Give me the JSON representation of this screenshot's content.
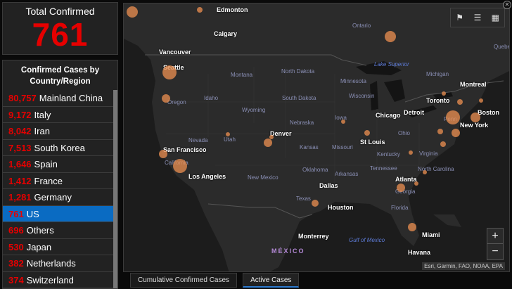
{
  "total": {
    "title": "Total Confirmed",
    "value": "761"
  },
  "list": {
    "title_line1": "Confirmed Cases by",
    "title_line2": "Country/Region",
    "items": [
      {
        "count": "80,757",
        "name": "Mainland China"
      },
      {
        "count": "9,172",
        "name": "Italy"
      },
      {
        "count": "8,042",
        "name": "Iran"
      },
      {
        "count": "7,513",
        "name": "South Korea"
      },
      {
        "count": "1,646",
        "name": "Spain"
      },
      {
        "count": "1,412",
        "name": "France"
      },
      {
        "count": "1,281",
        "name": "Germany"
      },
      {
        "count": "761",
        "name": "US"
      },
      {
        "count": "696",
        "name": "Others"
      },
      {
        "count": "530",
        "name": "Japan"
      },
      {
        "count": "382",
        "name": "Netherlands"
      },
      {
        "count": "374",
        "name": "Switzerland"
      }
    ],
    "selected_index": 7
  },
  "map": {
    "cities": [
      "Edmonton",
      "Calgary",
      "Vancouver",
      "Seattle",
      "San Francisco",
      "Los Angeles",
      "Denver",
      "Dallas",
      "Houston",
      "Chicago",
      "St Louis",
      "Atlanta",
      "Detroit",
      "Toronto",
      "Montreal",
      "New York",
      "Boston",
      "Miami",
      "Monterrey",
      "Havana"
    ],
    "regions": [
      "Ontario",
      "Quebec",
      "Montana",
      "North Dakota",
      "Minnesota",
      "South Dakota",
      "Wisconsin",
      "Wyoming",
      "Nebraska",
      "Iowa",
      "Idaho",
      "Oregon",
      "Nevada",
      "Utah",
      "California",
      "Kansas",
      "Missouri",
      "Oklahoma",
      "Arkansas",
      "Tennessee",
      "Kentucky",
      "Virginia",
      "North Carolina",
      "Georgia",
      "Florida",
      "Texas",
      "New Mexico",
      "Ohio",
      "Michigan",
      "Penn"
    ],
    "water": [
      "Lake Superior",
      "Gulf of Mexico"
    ],
    "country": "MÉXICO",
    "attribution": "Esri, Garmin, FAO, NOAA, EPA",
    "zoom_in": "+",
    "zoom_out": "−"
  },
  "tabs": [
    {
      "label": "Cumulative Confirmed Cases"
    },
    {
      "label": "Active Cases"
    }
  ],
  "colors": {
    "accent": "#0a6bc2",
    "count_red": "#e60000",
    "bubble": "#e68c50"
  },
  "icons": [
    "bookmark-icon",
    "list-icon",
    "qr-icon",
    "close-icon"
  ]
}
